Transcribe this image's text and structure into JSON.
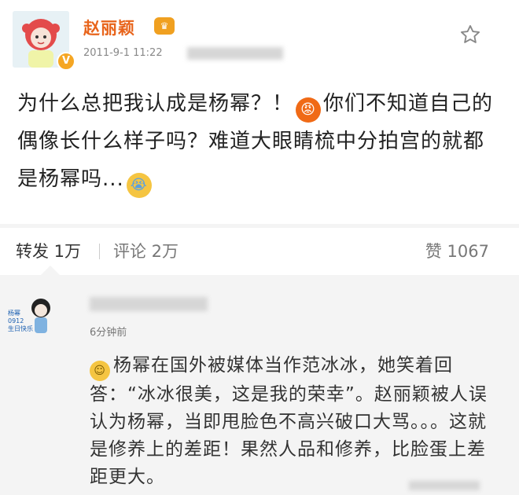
{
  "post": {
    "author": "赵丽颖",
    "vip_badge": "♛",
    "verified_mark": "V",
    "timestamp": "2011-9-1 11:22",
    "text_part1": "为什么总把我认成是杨幂？！",
    "text_part2": "你们不知道自己的偶像长什么样子吗？难道大眼睛梳中分拍宫的就都是杨幂吗...",
    "emoji_angry": "😡",
    "emoji_cry": "😭"
  },
  "actions": {
    "repost": "转发 1万",
    "comment": "评论 2万",
    "like": "赞 1067"
  },
  "comment": {
    "avatar_text_line1": "杨幂",
    "avatar_text_line2": "0912",
    "avatar_text_line3": "生日快乐",
    "time": "6分钟前",
    "emoji": "☺",
    "text": "杨幂在国外被媒体当作范冰冰，她笑着回答：“冰冰很美，这是我的荣幸”。赵丽颖被人误认为杨幂，当即甩脸色不高兴破口大骂。。。这就是修养上的差距！果然人品和修养，比脸蛋上差距更大。"
  },
  "colors": {
    "author": "#e8641b",
    "background": "#f4f4f4",
    "card": "#ffffff"
  }
}
